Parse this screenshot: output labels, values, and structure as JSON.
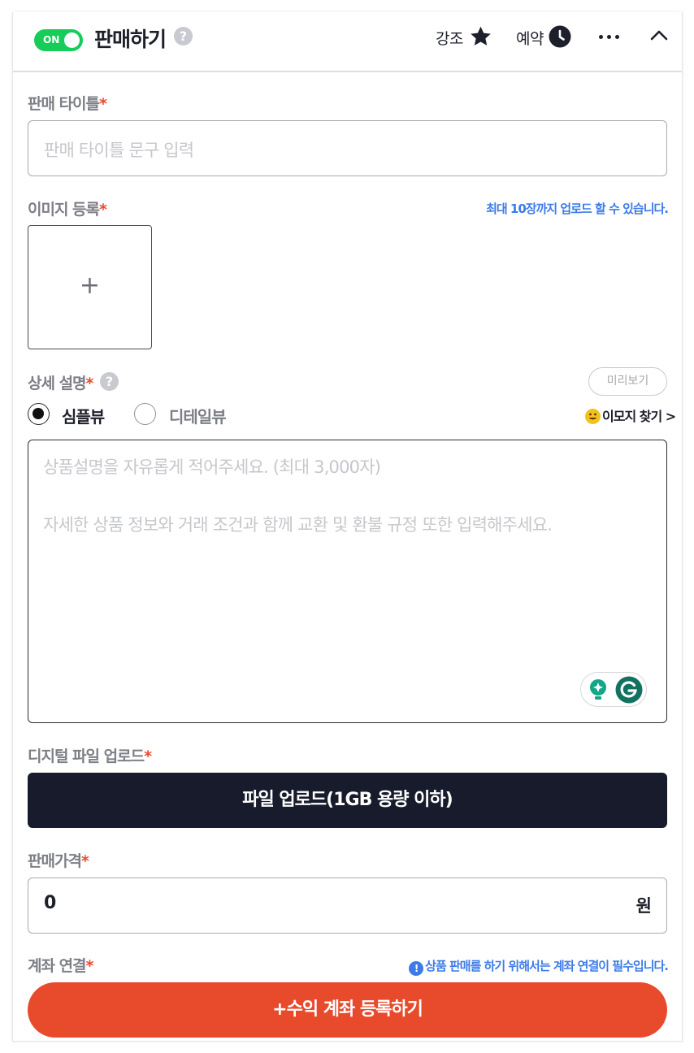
{
  "header": {
    "toggle_label": "ON",
    "title": "판매하기",
    "help_mark": "?",
    "highlight_label": "강조",
    "schedule_label": "예약"
  },
  "sale_title": {
    "label": "판매 타이틀",
    "required": "*",
    "placeholder": "판매 타이틀 문구 입력"
  },
  "image": {
    "label": "이미지 등록",
    "required": "*",
    "hint": "최대 10장까지 업로드 할 수 있습니다.",
    "add_symbol": "+"
  },
  "description": {
    "label": "상세 설명",
    "required": "*",
    "help_mark": "?",
    "preview_label": "미리보기",
    "view_simple": "심플뷰",
    "view_detail": "디테일뷰",
    "selected_view": "심플뷰",
    "emoji_link": "이모지 찾기 >",
    "placeholder_line1": "상품설명을 자유롭게 적어주세요. (최대 3,000자)",
    "placeholder_line2": "자세한 상품 정보와 거래 조건과 함께 교환 및 환불 규정 또한 입력해주세요."
  },
  "file": {
    "label": "디지털 파일 업로드",
    "required": "*",
    "button_label": "파일 업로드(1GB 용량 이하)"
  },
  "price": {
    "label": "판매가격",
    "required": "*",
    "value": "0",
    "unit": "원"
  },
  "account": {
    "label": "계좌 연결",
    "required": "*",
    "info_mark": "!",
    "hint": "상품 판매를 하기 위해서는 계좌 연결이 필수입니다.",
    "button_label": "+수익 계좌 등록하기"
  },
  "colors": {
    "toggle_on": "#17cc59",
    "required": "#e84b2c",
    "hint": "#3d7be8",
    "dark_button": "#171b2c",
    "orange_button": "#e84b2c"
  },
  "icons": [
    "question-icon",
    "star-icon",
    "clock-icon",
    "more-icon",
    "chevron-up-icon",
    "plus-icon",
    "emoji-icon",
    "grammarly-bulb-icon",
    "grammarly-g-icon",
    "info-icon"
  ]
}
